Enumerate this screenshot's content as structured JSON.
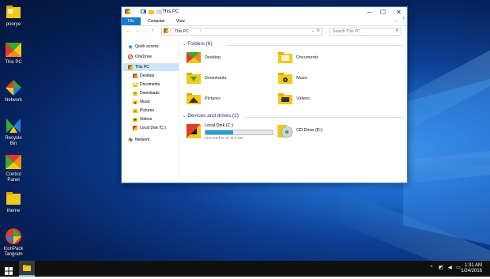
{
  "desktop": {
    "icons": [
      {
        "label": "poorye"
      },
      {
        "label": "This PC"
      },
      {
        "label": "Network"
      },
      {
        "label": "Recycle Bin"
      },
      {
        "label": "Control Panel"
      },
      {
        "label": "theme"
      },
      {
        "label": "IconPack Tangram"
      }
    ]
  },
  "window": {
    "title": "This PC",
    "ribbon_tabs": [
      "File",
      "Computer",
      "View"
    ],
    "address": "This PC",
    "search_placeholder": "Search This PC",
    "controls": {
      "minimize": "─",
      "maximize": "☐",
      "close": "✕"
    }
  },
  "nav": {
    "items": [
      {
        "label": "Quick access"
      },
      {
        "label": "OneDrive"
      },
      {
        "label": "This PC"
      },
      {
        "label": "Desktop"
      },
      {
        "label": "Documents"
      },
      {
        "label": "Downloads"
      },
      {
        "label": "Music"
      },
      {
        "label": "Pictures"
      },
      {
        "label": "Videos"
      },
      {
        "label": "Local Disk (C:)"
      },
      {
        "label": "Network"
      }
    ]
  },
  "content": {
    "folders_header": "Folders (6)",
    "folders": [
      {
        "label": "Desktop"
      },
      {
        "label": "Documents"
      },
      {
        "label": "Downloads"
      },
      {
        "label": "Music"
      },
      {
        "label": "Pictures"
      },
      {
        "label": "Videos"
      }
    ],
    "drives_header": "Devices and drives (2)",
    "drives": [
      {
        "label": "Local Disk (C:)",
        "free_text": "18.5 GB free of 31.5 GB",
        "used_fraction": 0.41
      },
      {
        "label": "CD Drive (D:)"
      }
    ]
  },
  "taskbar": {
    "time": "1:31 AM",
    "date": "1/24/2016"
  },
  "colors": {
    "accent": "#1979ca",
    "tangram_red": "#e23b2a",
    "tangram_green": "#3aa935",
    "tangram_yellow": "#f2c81b",
    "tangram_orange": "#f08a1c"
  }
}
